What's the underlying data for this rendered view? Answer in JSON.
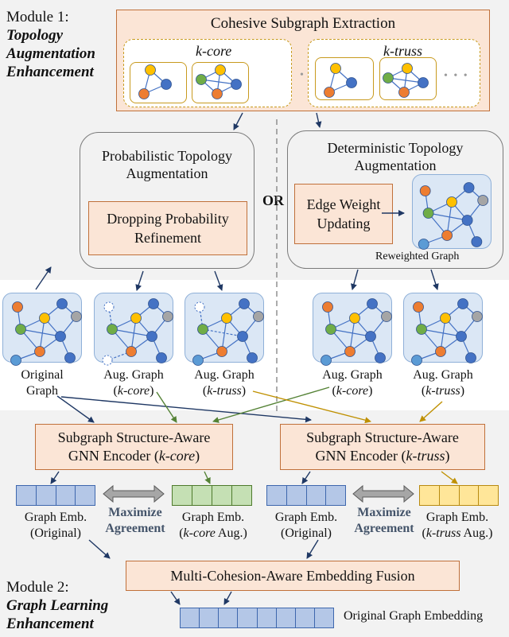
{
  "module1": {
    "prefix": "Module 1:",
    "title_lines": [
      "Topology",
      "Augmentation",
      "Enhancement"
    ]
  },
  "module2": {
    "prefix": "Module 2:",
    "title_lines": [
      "Graph Learning",
      "Enhancement"
    ]
  },
  "extraction": {
    "title": "Cohesive Subgraph Extraction",
    "groups": [
      {
        "label_italic": "k-core",
        "ellipsis": "• • •"
      },
      {
        "label_italic": "k-truss",
        "ellipsis": "• • •"
      }
    ]
  },
  "probabilistic": {
    "title_line1": "Probabilistic Topology",
    "title_line2": "Augmentation",
    "inner_line1": "Dropping Probability",
    "inner_line2": "Refinement"
  },
  "or_label": "OR",
  "deterministic": {
    "title_line1": "Deterministic Topology",
    "title_line2": "Augmentation",
    "inner_line1": "Edge Weight",
    "inner_line2": "Updating",
    "graph_caption": "Reweighted Graph"
  },
  "graphs": [
    {
      "line1": "Original",
      "line2": "Graph",
      "line2_italic": false
    },
    {
      "line1": "Aug. Graph",
      "line2": "k-core",
      "line2_italic": true
    },
    {
      "line1": "Aug. Graph",
      "line2": "k-truss",
      "line2_italic": true
    },
    {
      "line1": "Aug. Graph",
      "line2": "k-core",
      "line2_italic": true
    },
    {
      "line1": "Aug. Graph",
      "line2": "k-truss",
      "line2_italic": true
    }
  ],
  "encoders": [
    {
      "line1": "Subgraph Structure-Aware",
      "line2_prefix": "GNN Encoder (",
      "line2_italic": "k-core",
      "line2_suffix": ")"
    },
    {
      "line1": "Subgraph Structure-Aware",
      "line2_prefix": "GNN Encoder (",
      "line2_italic": "k-truss",
      "line2_suffix": ")"
    }
  ],
  "embeddings": [
    {
      "line1": "Graph Emb.",
      "line2_prefix": "(Original)",
      "line2_italic": "",
      "line2_suffix": "",
      "color": "blue"
    },
    {
      "line1": "Graph Emb.",
      "line2_prefix": "(",
      "line2_italic": "k-core",
      "line2_suffix": " Aug.)",
      "color": "green"
    },
    {
      "line1": "Graph Emb.",
      "line2_prefix": "(Original)",
      "line2_italic": "",
      "line2_suffix": "",
      "color": "blue"
    },
    {
      "line1": "Graph Emb.",
      "line2_prefix": "(",
      "line2_italic": "k-truss",
      "line2_suffix": " Aug.)",
      "color": "yellow"
    }
  ],
  "maximize": {
    "line1": "Maximize",
    "line2": "Agreement"
  },
  "fusion": {
    "title": "Multi-Cohesion-Aware Embedding Fusion"
  },
  "final_embedding": {
    "label": "Original Graph Embedding",
    "cells": 8
  },
  "colors": {
    "node_orange": "#ed7d31",
    "node_yellow": "#ffc000",
    "node_green": "#70ad47",
    "node_blue": "#4472c4",
    "node_lightblue": "#5b9bd5",
    "node_gray": "#a5a5a5",
    "arrow_navy": "#1f3864",
    "arrow_green": "#548235",
    "arrow_gold": "#bf9000"
  }
}
